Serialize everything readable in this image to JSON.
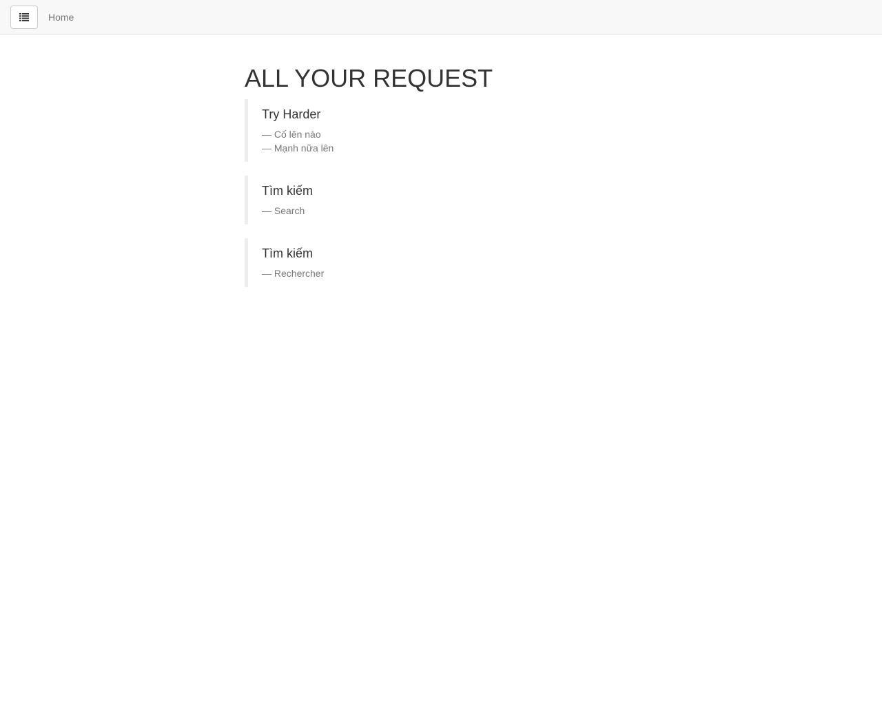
{
  "navbar": {
    "toggle_icon": "list-icon",
    "home_label": "Home"
  },
  "main": {
    "title": "ALL YOUR REQUEST",
    "requests": [
      {
        "title": "Try Harder",
        "translations": [
          "Cố lên nào",
          "Mạnh nữa lên"
        ]
      },
      {
        "title": "Tìm kiếm",
        "translations": [
          "Search"
        ]
      },
      {
        "title": "Tìm kiếm",
        "translations": [
          "Rechercher"
        ]
      }
    ]
  }
}
